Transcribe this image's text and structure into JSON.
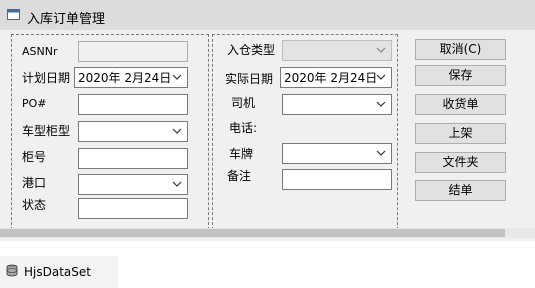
{
  "window": {
    "title": "入库订单管理"
  },
  "left_group": {
    "asnnr_label": "ASNNr",
    "plan_date_label": "计划日期",
    "plan_date_value": "2020年 2月24日",
    "po_label": "PO#",
    "vehicle_type_label": "车型柜型",
    "container_no_label": "柜号",
    "port_label": "港口",
    "status_label": "状态"
  },
  "middle_group": {
    "inbound_type_label": "入仓类型",
    "actual_date_label": "实际日期",
    "actual_date_value": "2020年 2月24日",
    "driver_label": "司机",
    "phone_label": "电话:",
    "plate_label": "车牌",
    "remark_label": "备注"
  },
  "buttons": {
    "cancel": "取消(C)",
    "save": "保存",
    "receive": "收货单",
    "shelve": "上架",
    "folder": "文件夹",
    "close_order": "结单"
  },
  "component_tray": {
    "dataset_label": "HjsDataSet"
  }
}
